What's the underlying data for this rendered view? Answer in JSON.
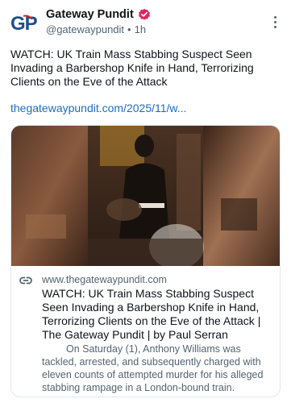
{
  "post": {
    "author_name": "Gateway Pundit",
    "handle": "@gatewaypundit",
    "time": "1h",
    "text": "WATCH: UK Train Mass Stabbing Suspect Seen Invading a Barbershop Knife in Hand, Terrorizing Clients on the Eve of the Attack",
    "link_text": "thegatewaypundit.com/2025/11/w..."
  },
  "avatar": {
    "initials": "GP",
    "color": "#1d4f8f"
  },
  "icons": {
    "verified": "verified-badge-icon",
    "more": "more-vertical-icon",
    "link": "link-icon"
  },
  "card": {
    "domain": "www.thegatewaypundit.com",
    "title": "WATCH: UK Train Mass Stabbing Suspect Seen Invading a Barbershop Knife in Hand, Terrorizing Clients on the Eve of the Attack | The Gateway Pundit | by Paul Serran",
    "description": "On Saturday (1), Anthony Williams was tackled, arrested, and subsequently charged with eleven counts of attempted murder for his alleged stabbing rampage in a London-bound train."
  },
  "colors": {
    "link": "#1a6ec4",
    "verified": "#e0245e",
    "secondary_text": "#536471",
    "card_border": "#e1e8ed"
  }
}
